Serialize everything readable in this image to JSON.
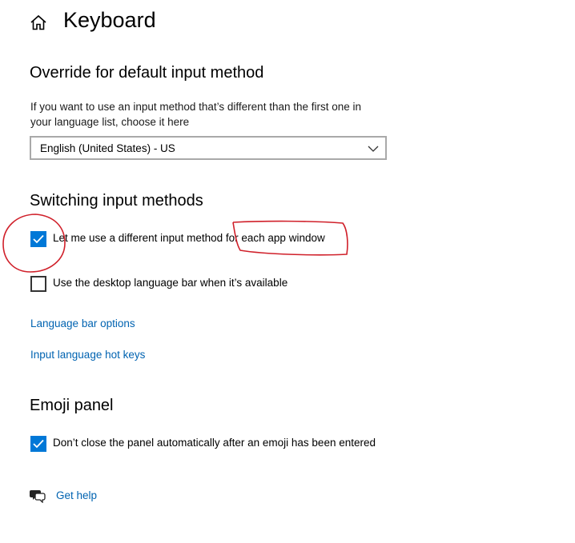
{
  "header": {
    "title": "Keyboard",
    "home_icon": "home-icon"
  },
  "override": {
    "title": "Override for default input method",
    "description_line1": "If you want to use an input method that’s different than the first one in",
    "description_line2": "your language list, choose it here",
    "dropdown_value": "English (United States) - US"
  },
  "switching": {
    "title": "Switching input methods",
    "checkbox1": {
      "label": "Let me use a different input method for each app window",
      "checked": true
    },
    "checkbox2": {
      "label": "Use the desktop language bar when it’s available",
      "checked": false
    },
    "link_language_bar": "Language bar options",
    "link_hot_keys": "Input language hot keys"
  },
  "emoji": {
    "title": "Emoji panel",
    "checkbox": {
      "label": "Don’t close the panel automatically after an emoji has been entered",
      "checked": true
    }
  },
  "help": {
    "label": "Get help",
    "icon": "help-chat-icon"
  },
  "colors": {
    "accent": "#0078d7",
    "link": "#0063b1",
    "annotation": "#d0202a"
  }
}
